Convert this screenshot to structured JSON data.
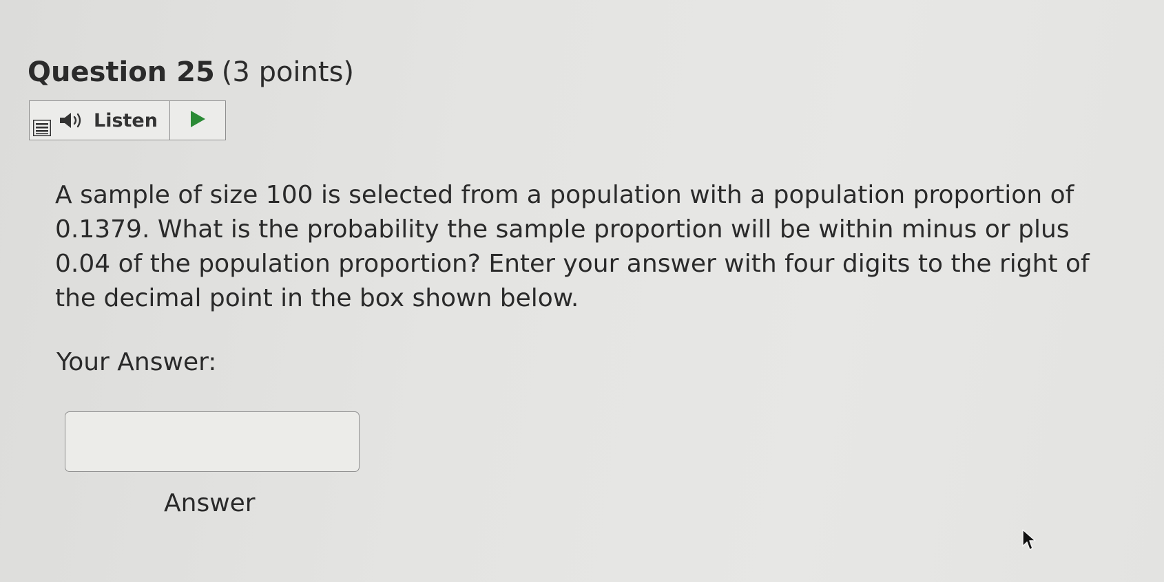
{
  "question": {
    "number_label": "Question 25",
    "points_label": "(3 points)"
  },
  "listen": {
    "label": "Listen",
    "menu_icon": "menu-icon",
    "speaker_icon": "speaker-icon",
    "play_icon": "play-icon"
  },
  "body": {
    "lines": [
      "A sample of size 100 is selected from a population with a population proportion of",
      "0.1379. What is the probability the sample proportion will be within minus or plus",
      "0.04 of the population proportion? Enter your answer with four digits to the right of",
      "the decimal point in the box shown below."
    ]
  },
  "answer": {
    "label": "Your Answer:",
    "value": "",
    "caption": "Answer"
  },
  "colors": {
    "play_green": "#2a8a35",
    "text": "#2a2a2a"
  }
}
